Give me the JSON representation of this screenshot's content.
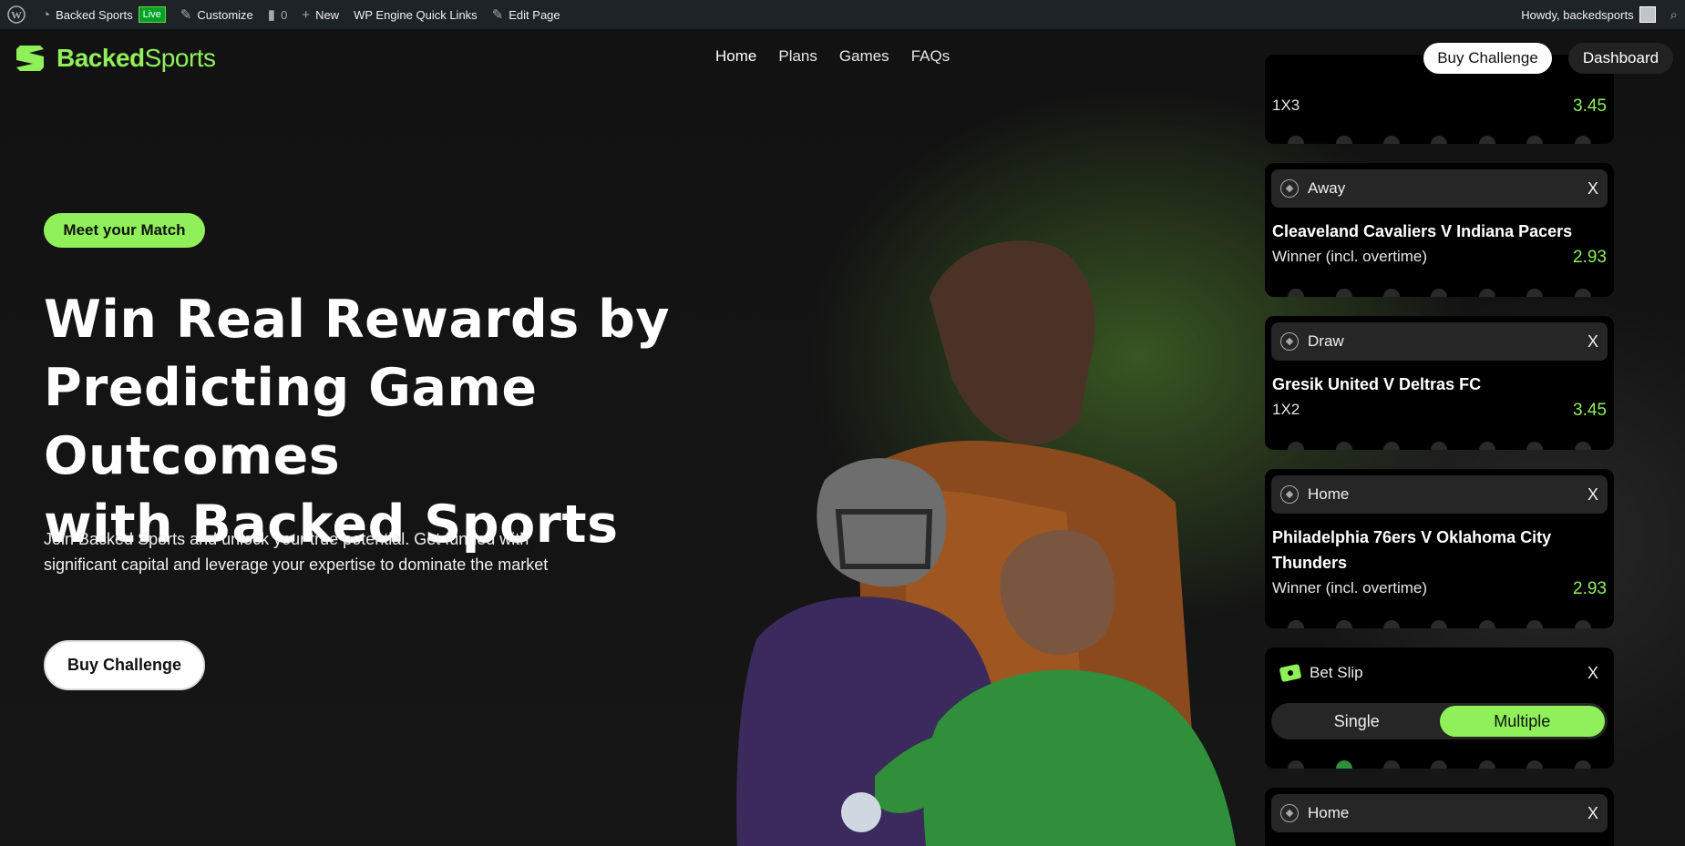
{
  "adminbar": {
    "site_name": "Backed Sports",
    "live_badge": "Live",
    "customize": "Customize",
    "comments_count": "0",
    "new": "New",
    "quick_links": "WP Engine Quick Links",
    "edit_page": "Edit Page",
    "howdy": "Howdy, backedsports"
  },
  "nav": {
    "logo_bold": "Backed",
    "logo_thin": "Sports",
    "links": [
      "Home",
      "Plans",
      "Games",
      "FAQs"
    ],
    "buy_challenge": "Buy Challenge",
    "dashboard": "Dashboard"
  },
  "hero": {
    "pill": "Meet your Match",
    "headline_1": "Win Real Rewards by",
    "headline_2": "Predicting Game Outcomes",
    "headline_3": "with Backed Sports",
    "subtext": "Join Backed Sports and unlock your true potential. Get funded with significant capital and leverage your expertise to dominate the market",
    "cta": "Buy Challenge"
  },
  "slips": [
    {
      "pick": "",
      "match": "",
      "market": "1X3",
      "odd": "3.45"
    },
    {
      "pick": "Away",
      "match": "Cleaveland Cavaliers V Indiana Pacers",
      "market": "Winner (incl. overtime)",
      "odd": "2.93"
    },
    {
      "pick": "Draw",
      "match": "Gresik United V Deltras FC",
      "market": "1X2",
      "odd": "3.45"
    },
    {
      "pick": "Home",
      "match": "Philadelphia 76ers V Oklahoma City Thunders",
      "market": "Winner (incl. overtime)",
      "odd": "2.93"
    }
  ],
  "betslip": {
    "title": "Bet Slip",
    "single": "Single",
    "multiple": "Multiple",
    "close": "X"
  },
  "bottom_slip": {
    "pick": "Home",
    "close": "X"
  },
  "colors": {
    "accent": "#8ff05a",
    "background": "#141414",
    "card": "#000000"
  }
}
